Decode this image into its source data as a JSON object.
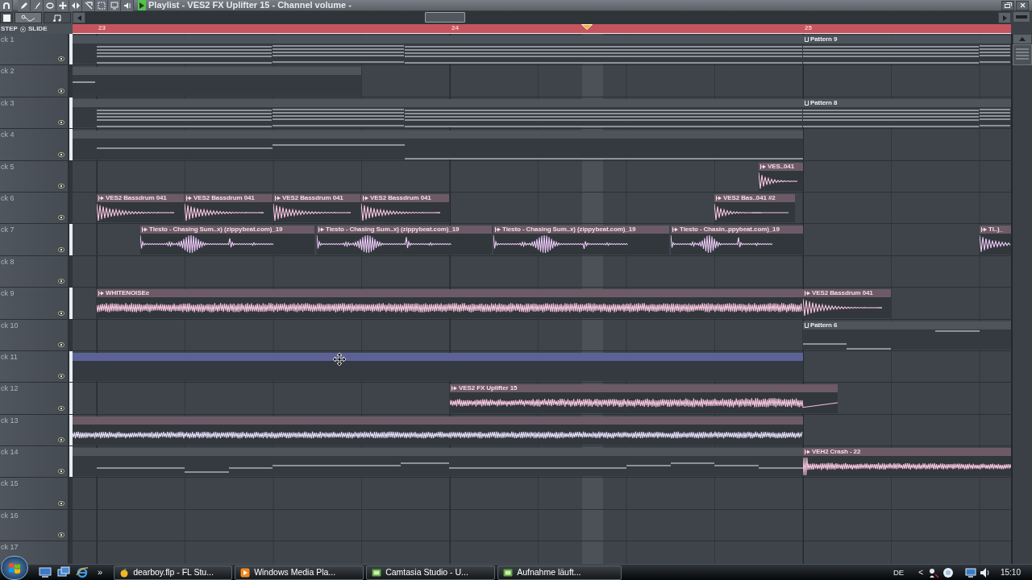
{
  "window": {
    "title": "Playlist - VES2 FX Uplifter 15 - Channel volume -"
  },
  "view_tabs": [
    {
      "selected": false
    },
    {
      "selected": true
    },
    {
      "selected": false
    }
  ],
  "snap_bar": {
    "step": "STEP",
    "slide": "SLIDE"
  },
  "timeline": {
    "bars": [
      "23",
      "24",
      "25"
    ]
  },
  "tracks": [
    {
      "name": "ck 1",
      "lit": true,
      "clips": [
        {
          "kind": "pattern",
          "selected": false
        },
        {
          "kind": "pattern",
          "label": "Pattern 9",
          "selected": false
        }
      ]
    },
    {
      "name": "ck 2",
      "lit": false,
      "clips": [
        {
          "kind": "pattern",
          "selected": false
        }
      ]
    },
    {
      "name": "ck 3",
      "lit": true,
      "clips": [
        {
          "kind": "pattern",
          "selected": false
        },
        {
          "kind": "pattern",
          "label": "Pattern 8",
          "selected": false
        }
      ]
    },
    {
      "name": "ck 4",
      "lit": true,
      "clips": [
        {
          "kind": "pattern",
          "selected": false
        }
      ]
    },
    {
      "name": "ck 5",
      "lit": false,
      "clips": [
        {
          "kind": "audio",
          "label": "VES..041",
          "color": "#f8c6dc",
          "selected": false
        }
      ]
    },
    {
      "name": "ck 6",
      "lit": false,
      "clips": [
        {
          "kind": "audio",
          "label": "VES2 Bassdrum 041",
          "color": "#f8c6dc",
          "selected": false
        },
        {
          "kind": "audio",
          "label": "VES2 Bassdrum 041",
          "color": "#f8c6dc",
          "selected": false
        },
        {
          "kind": "audio",
          "label": "VES2 Bassdrum 041",
          "color": "#f8c6dc",
          "selected": false
        },
        {
          "kind": "audio",
          "label": "VES2 Bassdrum 041",
          "color": "#f8c6dc",
          "selected": false
        },
        {
          "kind": "audio",
          "label": "VES2 Bas..041 #2",
          "color": "#f8c6dc",
          "selected": false
        }
      ]
    },
    {
      "name": "ck 7",
      "lit": true,
      "clips": [
        {
          "kind": "audio",
          "label": "Tiesto - Chasing Sum..x) (zippybeat.com)_19",
          "color": "#ebcaf6",
          "selected": false
        },
        {
          "kind": "audio",
          "label": "Tiesto - Chasing Sum..x) (zippybeat.com)_19",
          "color": "#ebcaf6",
          "selected": false
        },
        {
          "kind": "audio",
          "label": "Tiesto - Chasing Sum..x) (zippybeat.com)_19",
          "color": "#ebcaf6",
          "selected": false
        },
        {
          "kind": "audio",
          "label": "Tiesto - Chasin..ppybeat.com)_19",
          "color": "#ebcaf6",
          "selected": false
        },
        {
          "kind": "audio",
          "label": "Ti..)_",
          "color": "#ebcaf6",
          "selected": false
        }
      ]
    },
    {
      "name": "ck 8",
      "lit": false
    },
    {
      "name": "ck 9",
      "lit": true,
      "clips": [
        {
          "kind": "audio",
          "label": "WHITENOISEe",
          "color": "#f8c6dc",
          "selected": false
        },
        {
          "kind": "audio",
          "label": "VES2 Bassdrum 041",
          "color": "#f8c6dc",
          "selected": false
        }
      ]
    },
    {
      "name": "ck 10",
      "lit": false,
      "clips": [
        {
          "kind": "pattern",
          "label": "Pattern 6",
          "selected": false
        }
      ]
    },
    {
      "name": "ck 11",
      "lit": true,
      "clips": [
        {
          "kind": "pattern",
          "selected": true
        }
      ]
    },
    {
      "name": "ck 12",
      "lit": true,
      "clips": [
        {
          "kind": "audio",
          "label": "VES2 FX Uplifter 15",
          "color": "#f8c6dc",
          "selected": false
        }
      ]
    },
    {
      "name": "ck 13",
      "lit": true,
      "clips": [
        {
          "kind": "audio",
          "color": "#e2dcf7",
          "selected": false
        }
      ]
    },
    {
      "name": "ck 14",
      "lit": true,
      "clips": [
        {
          "kind": "pattern",
          "selected": false
        },
        {
          "kind": "audio",
          "label": "VEH2 Crash - 22",
          "color": "#f8c6dc",
          "selected": false
        }
      ]
    },
    {
      "name": "ck 15",
      "lit": false
    },
    {
      "name": "ck 16",
      "lit": false
    },
    {
      "name": "ck 17",
      "lit": false
    }
  ],
  "taskbar": {
    "overflow": "»",
    "tasks": [
      {
        "label": "dearboy.flp - FL Stu..."
      },
      {
        "label": "Windows Media Pla..."
      },
      {
        "label": "Camtasia Studio - U..."
      },
      {
        "label": "Aufnahme läuft..."
      }
    ],
    "language": "DE",
    "tray_toggle": "<",
    "clock": "15:10"
  }
}
